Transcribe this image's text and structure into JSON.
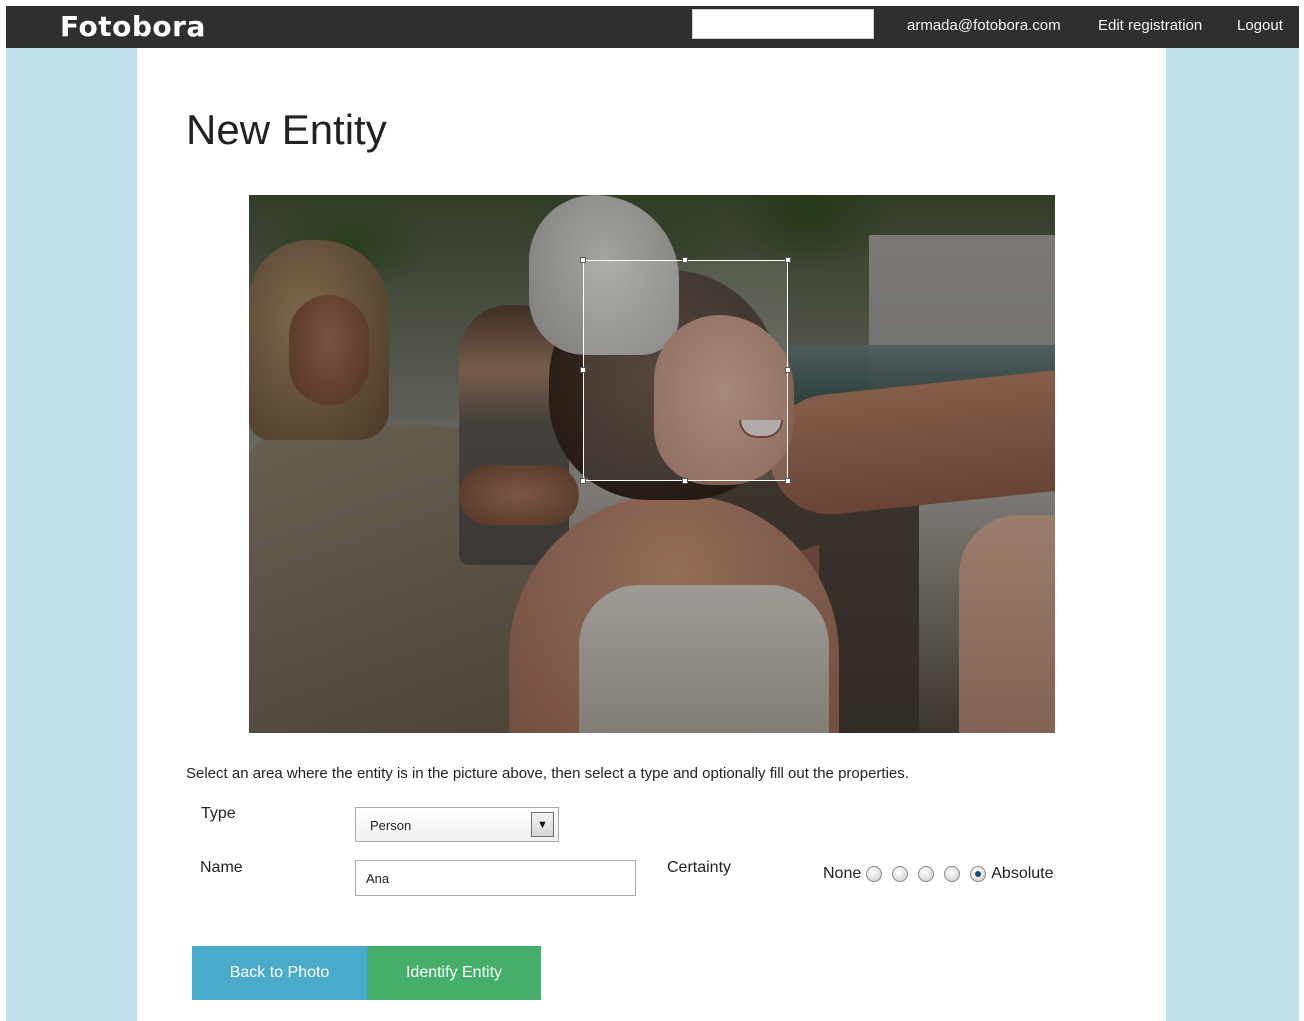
{
  "header": {
    "brand": "Fotobora",
    "search_value": "",
    "user_email": "armada@fotobora.com",
    "edit_registration": "Edit registration",
    "logout": "Logout"
  },
  "page": {
    "title": "New Entity",
    "instructions": "Select an area where the entity is in the picture above, then select a type and optionally fill out the properties."
  },
  "form": {
    "type_label": "Type",
    "type_value": "Person",
    "name_label": "Name",
    "name_value": "Ana",
    "certainty_label": "Certainty",
    "certainty_min": "None",
    "certainty_max": "Absolute",
    "certainty_selected_index": 5,
    "certainty_options_count": 5
  },
  "buttons": {
    "back": "Back to Photo",
    "identify": "Identify Entity"
  },
  "colors": {
    "header_bg": "#2f2f2f",
    "frame_bg": "#c2e0ea",
    "back_button": "#4aaac9",
    "identify_button": "#45ae6a"
  },
  "icons": {
    "select_arrow": "chevron-down-icon"
  }
}
